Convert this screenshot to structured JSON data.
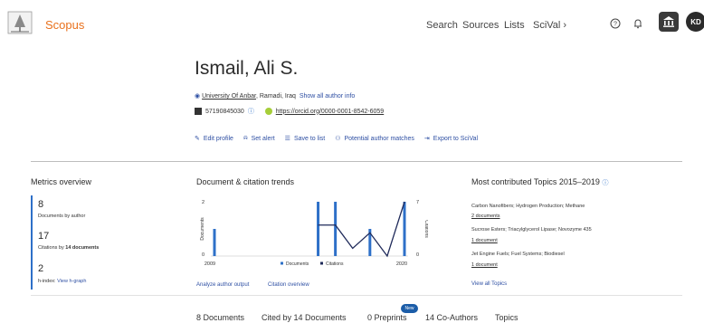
{
  "header": {
    "brand": "Scopus",
    "nav": [
      "Search",
      "Sources",
      "Lists",
      "SciVal ›"
    ],
    "avatar_initials": "KD",
    "icons": [
      "help-icon",
      "bell-icon",
      "institution-icon"
    ]
  },
  "author": {
    "name": "Ismail, Ali S.",
    "affiliation": "University Of Anbar",
    "location": ", Ramadi, Iraq",
    "show_info": "Show all author info",
    "scopus_id": "57190845030",
    "orcid": "https://orcid.org/0000-0001-8542-6059"
  },
  "actions": [
    "Edit profile",
    "Set alert",
    "Save to list",
    "Potential author matches",
    "Export to SciVal"
  ],
  "metrics": {
    "title": "Metrics overview",
    "documents_value": "8",
    "documents_label": "Documents by author",
    "citations_value": "17",
    "citations_label_prefix": "Citations by ",
    "citations_label_count": "14 documents",
    "hindex_value": "2",
    "hindex_label": "h-index:",
    "hindex_link": "View h-graph"
  },
  "trends": {
    "title": "Document & citation trends",
    "analyze_link": "Analyze author output",
    "citation_link": "Citation overview"
  },
  "chart_data": {
    "type": "bar",
    "x_labels": [
      "2009",
      "2020"
    ],
    "years": [
      2009,
      2010,
      2011,
      2012,
      2013,
      2014,
      2015,
      2016,
      2017,
      2018,
      2019,
      2020
    ],
    "documents": [
      1,
      0,
      0,
      0,
      0,
      0,
      2,
      2,
      0,
      1,
      0,
      2
    ],
    "citations": [
      null,
      null,
      null,
      null,
      null,
      null,
      4,
      4,
      1,
      3,
      0,
      7
    ],
    "ylabel_left": "Documents",
    "ylabel_right": "Citations",
    "left_ticks": [
      "2",
      "0"
    ],
    "right_ticks": [
      "7",
      "0"
    ],
    "legend": [
      "Documents",
      "Citations"
    ],
    "colors": {
      "documents": "#2e70c8",
      "citations": "#1f2a5a"
    }
  },
  "topics": {
    "title": "Most contributed Topics 2015–2019",
    "items": [
      {
        "name": "Carbon Nanofibers; Hydrogen Production; Methane",
        "docs": "2 documents"
      },
      {
        "name": "Sucrose Esters; Triacylglycerol Lipase; Novozyme 435",
        "docs": "1 document"
      },
      {
        "name": "Jet Engine Fuels; Fuel Systems; Biodiesel",
        "docs": "1 document"
      }
    ],
    "view_all": "View all Topics"
  },
  "tabs": {
    "items": [
      "8 Documents",
      "Cited by 14 Documents",
      "0 Preprints",
      "14 Co-Authors",
      "Topics"
    ],
    "new_badge": "New"
  }
}
